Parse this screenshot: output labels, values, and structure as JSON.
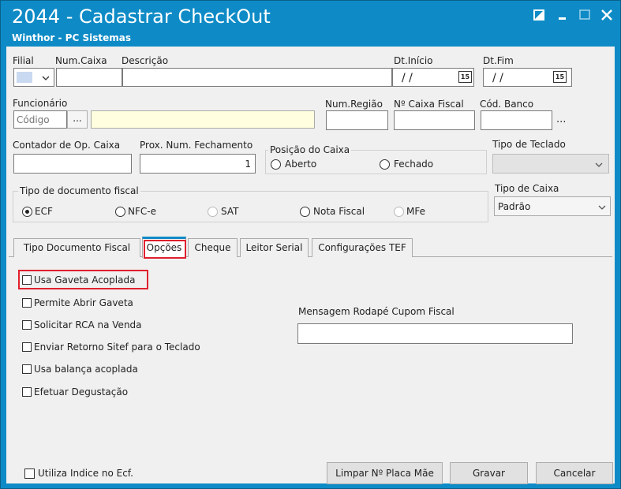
{
  "window": {
    "title": "2044 - Cadastrar CheckOut",
    "subtitle": "Winthor - PC Sistemas"
  },
  "header": {
    "filial_label": "Filial",
    "numcaixa_label": "Num.Caixa",
    "descricao_label": "Descrição",
    "dtinicio_label": "Dt.Início",
    "dtinicio_value": "/ /",
    "dtfim_label": "Dt.Fim",
    "dtfim_value": "/ /",
    "calendar_label": "15",
    "funcionario_label": "Funcionário",
    "codigo_placeholder": "Código",
    "lookup_label": "...",
    "numregiao_label": "Num.Região",
    "ncaixafiscal_label": "Nº Caixa Fiscal",
    "codbanco_label": "Cód. Banco",
    "codbanco_ellipsis": "...",
    "contador_label": "Contador de Op. Caixa",
    "proxnum_label": "Prox. Num. Fechamento",
    "proxnum_value": "1",
    "posicao_label": "Posição do Caixa",
    "posicao_aberto": "Aberto",
    "posicao_fechado": "Fechado",
    "tipoteclado_label": "Tipo de Teclado",
    "tipodoc_label": "Tipo de documento fiscal",
    "tipodoc_ecf": "ECF",
    "tipodoc_nfce": "NFC-e",
    "tipodoc_sat": "SAT",
    "tipodoc_nota": "Nota Fiscal",
    "tipodoc_mfe": "MFe",
    "tipocaixa_label": "Tipo de Caixa",
    "tipocaixa_value": "Padrão"
  },
  "tabs": [
    {
      "label": "Tipo Documento Fiscal"
    },
    {
      "label": "Opções"
    },
    {
      "label": "Cheque"
    },
    {
      "label": "Leitor Serial"
    },
    {
      "label": "Configurações TEF"
    }
  ],
  "options": {
    "usa_gaveta": "Usa Gaveta Acoplada",
    "permite_abrir": "Permite Abrir Gaveta",
    "solicitar_rca": "Solicitar RCA na Venda",
    "enviar_retorno": "Enviar Retorno Sitef para o Teclado",
    "usa_balanca": "Usa balança acoplada",
    "efetuar_degustacao": "Efetuar Degustação",
    "mensagem_label": "Mensagem Rodapé Cupom Fiscal"
  },
  "footer": {
    "utiliza_indice": "Utiliza Indice no Ecf.",
    "limpar_label": "Limpar Nº Placa Mãe",
    "gravar_label": "Gravar",
    "cancelar_label": "Cancelar"
  },
  "colors": {
    "titlebar": "#0e8bc6",
    "highlight": "#e0202e",
    "funcionario_field": "#ffffdf"
  }
}
